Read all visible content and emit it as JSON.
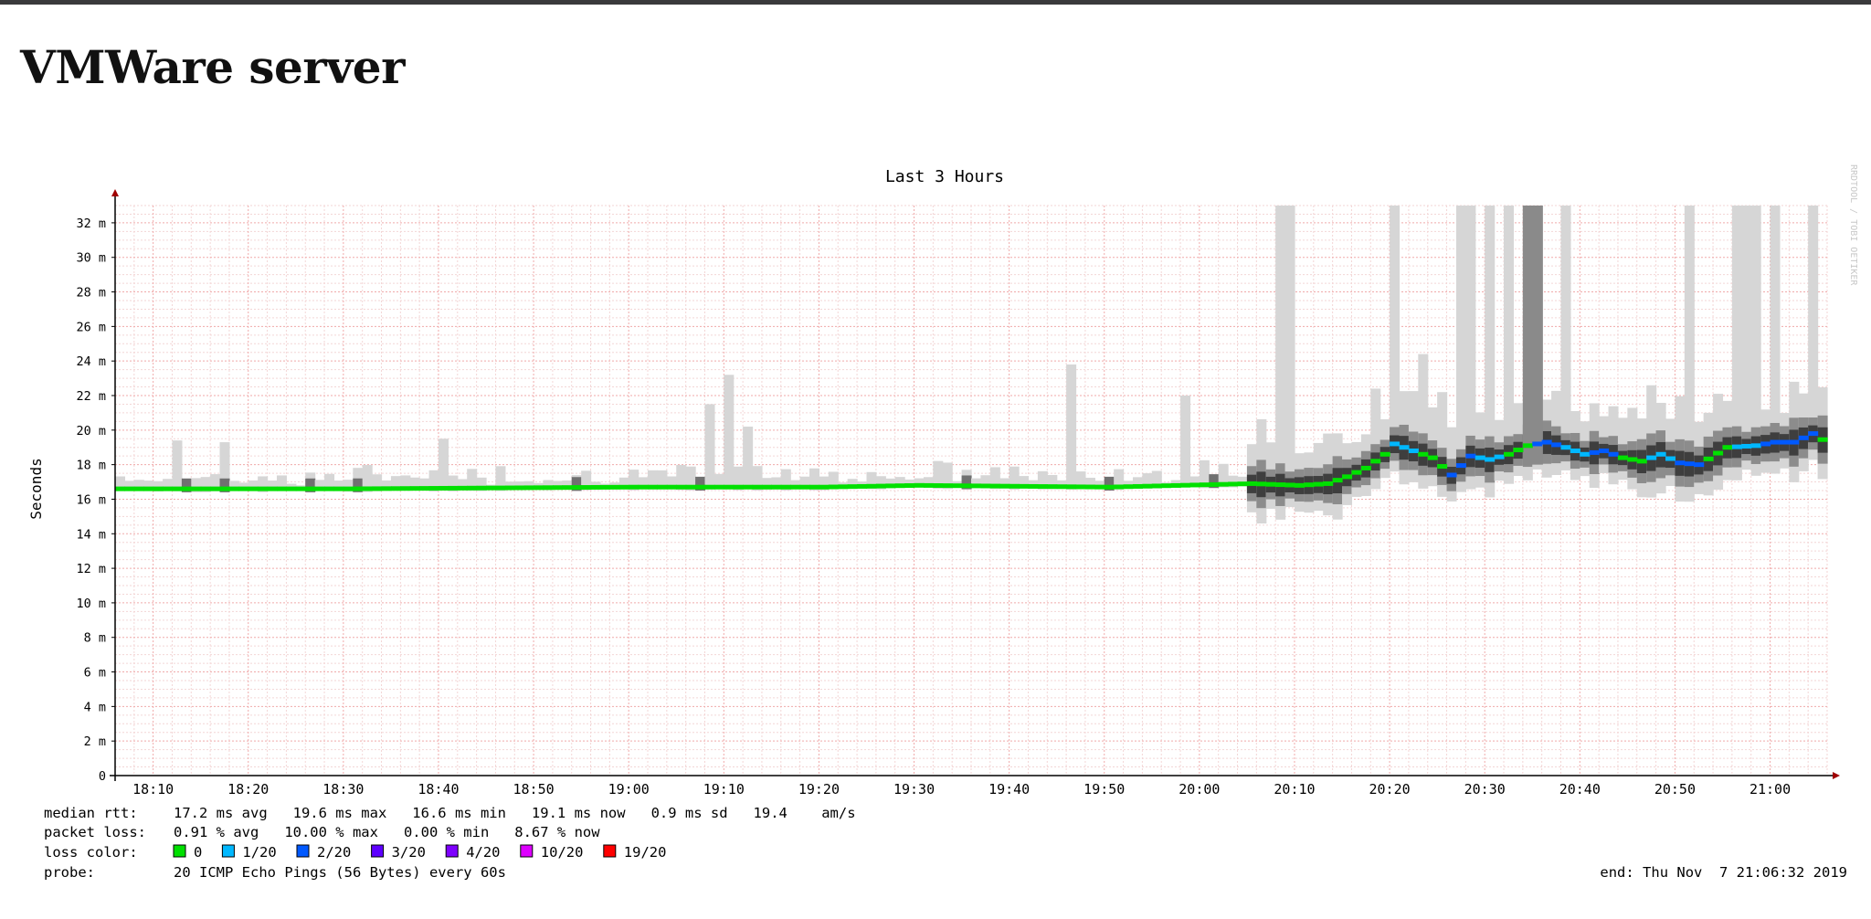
{
  "page": {
    "title": "VMWare server"
  },
  "chart_data": {
    "type": "area",
    "title": "Last 3 Hours",
    "ylabel": "Seconds",
    "ylim": [
      0,
      33
    ],
    "y_ticks": [
      {
        "v": 0,
        "label": "0"
      },
      {
        "v": 2,
        "label": "2 m"
      },
      {
        "v": 4,
        "label": "4 m"
      },
      {
        "v": 6,
        "label": "6 m"
      },
      {
        "v": 8,
        "label": "8 m"
      },
      {
        "v": 10,
        "label": "10 m"
      },
      {
        "v": 12,
        "label": "12 m"
      },
      {
        "v": 14,
        "label": "14 m"
      },
      {
        "v": 16,
        "label": "16 m"
      },
      {
        "v": 18,
        "label": "18 m"
      },
      {
        "v": 20,
        "label": "20 m"
      },
      {
        "v": 22,
        "label": "22 m"
      },
      {
        "v": 24,
        "label": "24 m"
      },
      {
        "v": 26,
        "label": "26 m"
      },
      {
        "v": 28,
        "label": "28 m"
      },
      {
        "v": 30,
        "label": "30 m"
      },
      {
        "v": 32,
        "label": "32 m"
      }
    ],
    "xlim": [
      "18:06",
      "21:06"
    ],
    "x_ticks": [
      "18:10",
      "18:20",
      "18:30",
      "18:40",
      "18:50",
      "19:00",
      "19:10",
      "19:20",
      "19:30",
      "19:40",
      "19:50",
      "20:00",
      "20:10",
      "20:20",
      "20:30",
      "20:40",
      "20:50",
      "21:00"
    ],
    "grid": true,
    "watermark": "RRDTOOL / TOBI OETIKER",
    "median_rtt_ms": [
      {
        "t": "18:06",
        "v": 16.6
      },
      {
        "t": "18:30",
        "v": 16.6
      },
      {
        "t": "19:00",
        "v": 16.7
      },
      {
        "t": "19:20",
        "v": 16.7
      },
      {
        "t": "19:30",
        "v": 16.8
      },
      {
        "t": "19:50",
        "v": 16.7
      },
      {
        "t": "20:05",
        "v": 16.9
      },
      {
        "t": "20:10",
        "v": 16.8
      },
      {
        "t": "20:13",
        "v": 16.9
      },
      {
        "t": "20:15",
        "v": 17.3
      },
      {
        "t": "20:17",
        "v": 17.8
      },
      {
        "t": "20:19",
        "v": 18.6
      },
      {
        "t": "20:20",
        "v": 19.2
      },
      {
        "t": "20:22",
        "v": 18.8
      },
      {
        "t": "20:24",
        "v": 18.4
      },
      {
        "t": "20:26",
        "v": 17.4
      },
      {
        "t": "20:28",
        "v": 18.5
      },
      {
        "t": "20:30",
        "v": 18.3
      },
      {
        "t": "20:32",
        "v": 18.6
      },
      {
        "t": "20:34",
        "v": 19.1
      },
      {
        "t": "20:36",
        "v": 19.3
      },
      {
        "t": "20:38",
        "v": 19.0
      },
      {
        "t": "20:40",
        "v": 18.6
      },
      {
        "t": "20:42",
        "v": 18.8
      },
      {
        "t": "20:44",
        "v": 18.4
      },
      {
        "t": "20:46",
        "v": 18.2
      },
      {
        "t": "20:48",
        "v": 18.6
      },
      {
        "t": "20:50",
        "v": 18.1
      },
      {
        "t": "20:52",
        "v": 18.0
      },
      {
        "t": "20:55",
        "v": 19.0
      },
      {
        "t": "20:58",
        "v": 19.1
      },
      {
        "t": "21:00",
        "v": 19.3
      },
      {
        "t": "21:02",
        "v": 19.3
      },
      {
        "t": "21:04",
        "v": 19.8
      },
      {
        "t": "21:06",
        "v": 19.1
      }
    ],
    "loss_colors": [
      {
        "label": "0",
        "color": "#00e000"
      },
      {
        "label": "1/20",
        "color": "#00b8ff"
      },
      {
        "label": "2/20",
        "color": "#0059ff"
      },
      {
        "label": "3/20",
        "color": "#5e00ff"
      },
      {
        "label": "4/20",
        "color": "#7e00ff"
      },
      {
        "label": "10/20",
        "color": "#dd00ff"
      },
      {
        "label": "19/20",
        "color": "#ff0000"
      }
    ],
    "footer": {
      "median_rtt_label": "median rtt:",
      "median_rtt_values": "17.2 ms avg   19.6 ms max   16.6 ms min   19.1 ms now   0.9 ms sd   19.4    am/s",
      "packet_loss_label": "packet loss:",
      "packet_loss_values": "0.91 % avg   10.00 % max   0.00 % min   8.67 % now",
      "loss_color_label": "loss color:",
      "probe_label": "probe:",
      "probe_value": "20 ICMP Echo Pings (56 Bytes) every 60s",
      "end": "end: Thu Nov  7 21:06:32 2019"
    }
  }
}
